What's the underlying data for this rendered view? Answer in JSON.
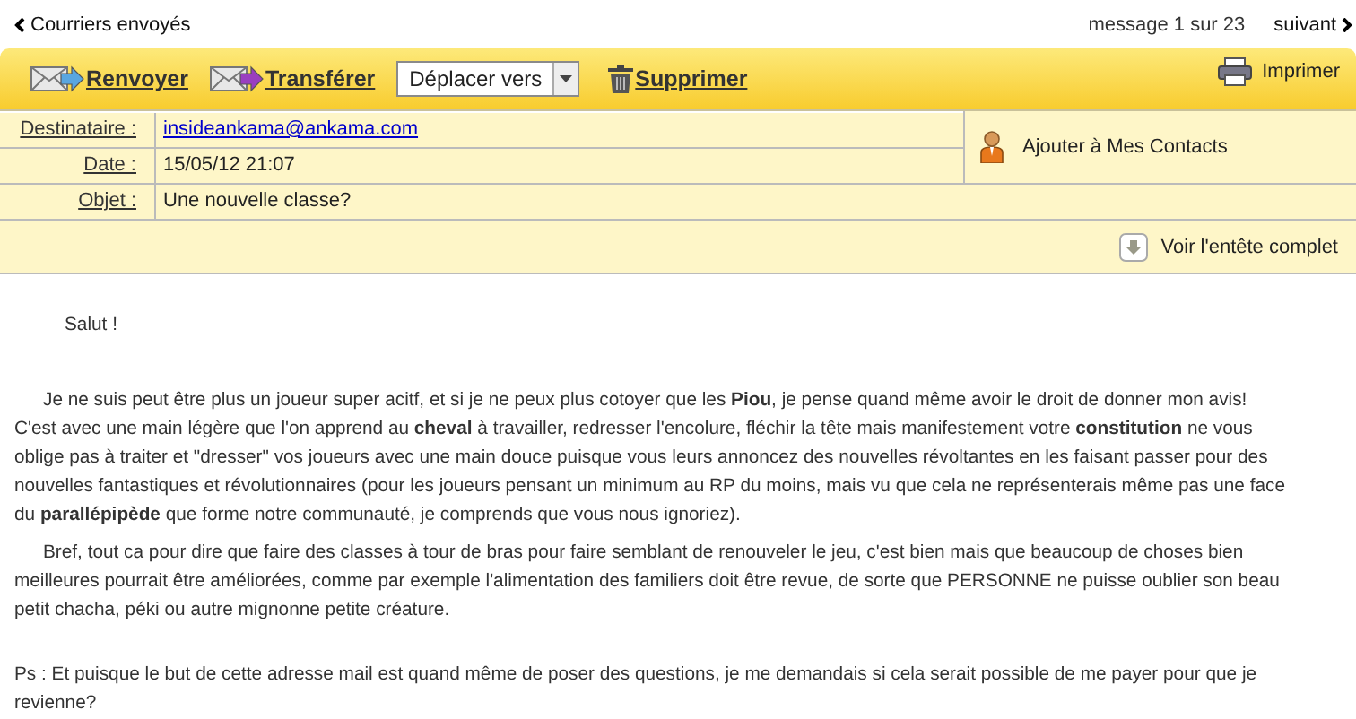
{
  "nav": {
    "back": "Courriers envoyés",
    "counter": "message 1 sur 23",
    "next": "suivant"
  },
  "toolbar": {
    "actions": [
      {
        "kind": "reply",
        "label": "Renvoyer"
      },
      {
        "kind": "forward",
        "label": "Transférer"
      },
      {
        "kind": "move",
        "label": "Déplacer vers"
      },
      {
        "kind": "delete",
        "label": "Supprimer"
      }
    ],
    "print": "Imprimer"
  },
  "header": {
    "fields": [
      {
        "label": "Destinataire :",
        "value": "insideankama@ankama.com",
        "kind": "link"
      },
      {
        "label": "Date :",
        "value": "15/05/12 21:07",
        "kind": "text"
      },
      {
        "label": "Objet :",
        "value": "Une nouvelle classe?",
        "kind": "text"
      }
    ],
    "add_contact": "Ajouter à Mes Contacts",
    "full_header": "Voir l'entête complet"
  },
  "body": [
    {
      "kind": "greeting",
      "lines": [
        "Salut !"
      ]
    },
    {
      "kind": "paragraph",
      "lines": [
        "Je ne suis peut être plus un joueur super acitf, et si je ne peux plus cotoyer que les **Piou**, je pense quand même avoir le droit de donner mon avis!",
        "C'est avec une main légère que l'on apprend au **cheval** à travailler, redresser l'encolure, fléchir la tête mais manifestement votre **constitution** ne vous",
        "oblige pas à traiter et \"dresser\" vos joueurs avec une main douce puisque vous leurs annoncez des nouvelles révoltantes en les faisant passer pour des",
        "nouvelles fantastiques et révolutionnaires (pour les joueurs pensant un minimum au RP du moins, mais vu que cela ne représenterais même pas une face",
        "du **parallépipède** que forme notre communauté, je comprends que vous nous ignoriez)."
      ]
    },
    {
      "kind": "paragraph",
      "lines": [
        "Bref, tout ca pour dire que faire des classes à tour de bras pour faire semblant de renouveler le jeu, c'est bien mais que beaucoup de choses bien",
        "meilleures pourrait être améliorées, comme par exemple l'alimentation des familiers doit être revue, de sorte que PERSONNE ne puisse oublier son beau",
        "petit chacha, péki ou autre mignonne petite créature."
      ]
    },
    {
      "kind": "ps",
      "lines": [
        "Ps : Et puisque le but de cette adresse mail est quand même de poser des questions, je me demandais si cela serait possible de me payer pour que je",
        "revienne?"
      ]
    }
  ]
}
